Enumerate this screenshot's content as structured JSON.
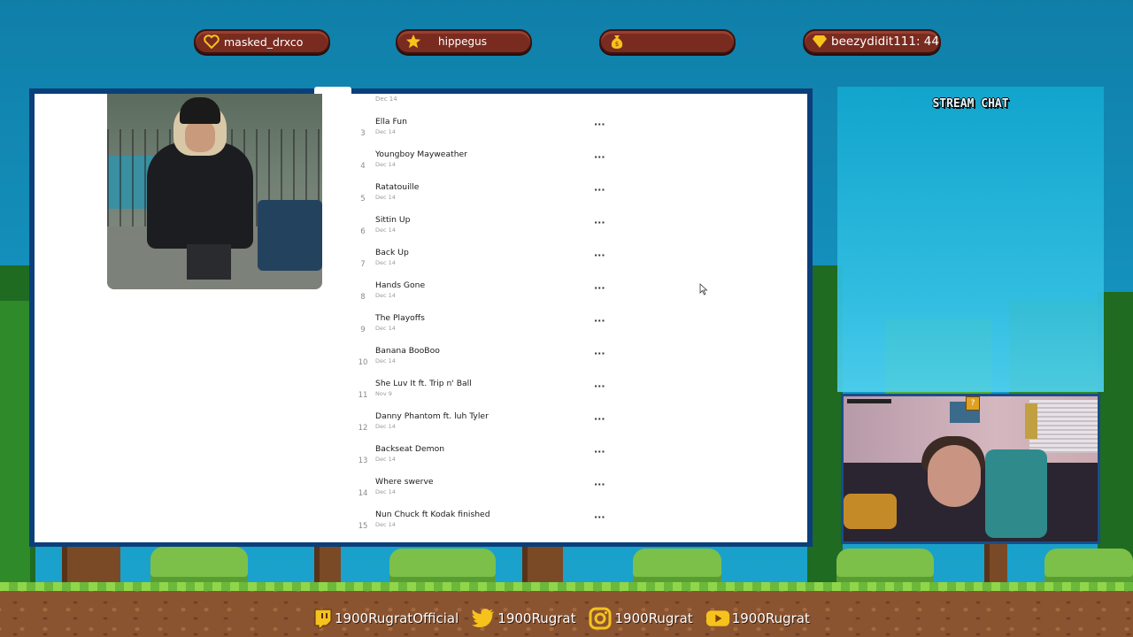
{
  "top_pills": [
    {
      "icon": "heart-icon",
      "label": "masked_drxco"
    },
    {
      "icon": "star-icon",
      "label": "hippegus"
    },
    {
      "icon": "money-bag-icon",
      "label": ""
    },
    {
      "icon": "diamond-icon",
      "label": "beezydidit111: 44"
    }
  ],
  "tracklist": {
    "partial_top_date": "Dec 14",
    "tracks": [
      {
        "number": "3",
        "title": "Ella Fun",
        "date": "Dec 14"
      },
      {
        "number": "4",
        "title": "Youngboy Mayweather",
        "date": "Dec 14"
      },
      {
        "number": "5",
        "title": "Ratatouille",
        "date": "Dec 14"
      },
      {
        "number": "6",
        "title": "Sittin Up",
        "date": "Dec 14"
      },
      {
        "number": "7",
        "title": "Back Up",
        "date": "Dec 14"
      },
      {
        "number": "8",
        "title": "Hands Gone",
        "date": "Dec 14"
      },
      {
        "number": "9",
        "title": "The Playoffs",
        "date": "Dec 14"
      },
      {
        "number": "10",
        "title": "Banana BooBoo",
        "date": "Dec 14"
      },
      {
        "number": "11",
        "title": "She Luv It ft. Trip n' Ball",
        "date": "Nov 9"
      },
      {
        "number": "12",
        "title": "Danny Phantom ft. luh Tyler",
        "date": "Dec 14"
      },
      {
        "number": "13",
        "title": "Backseat Demon",
        "date": "Dec 14"
      },
      {
        "number": "14",
        "title": "Where swerve",
        "date": "Dec 14"
      },
      {
        "number": "15",
        "title": "Nun Chuck ft Kodak finished",
        "date": "Dec 14"
      }
    ],
    "more_label": "···"
  },
  "chat": {
    "title": "STREAM CHAT"
  },
  "webcam": {
    "overlay_badge": "?"
  },
  "socials": [
    {
      "icon": "twitch-icon",
      "label": "1900RugratOfficial"
    },
    {
      "icon": "twitter-icon",
      "label": "1900Rugrat"
    },
    {
      "icon": "instagram-icon",
      "label": "1900Rugrat"
    },
    {
      "icon": "youtube-icon",
      "label": "1900Rugrat"
    }
  ],
  "colors": {
    "sky": "#1491bd",
    "pill": "#7a2b20",
    "frame": "#0b3f7a",
    "grass": "#8fd64a",
    "dirt": "#8a5431"
  }
}
